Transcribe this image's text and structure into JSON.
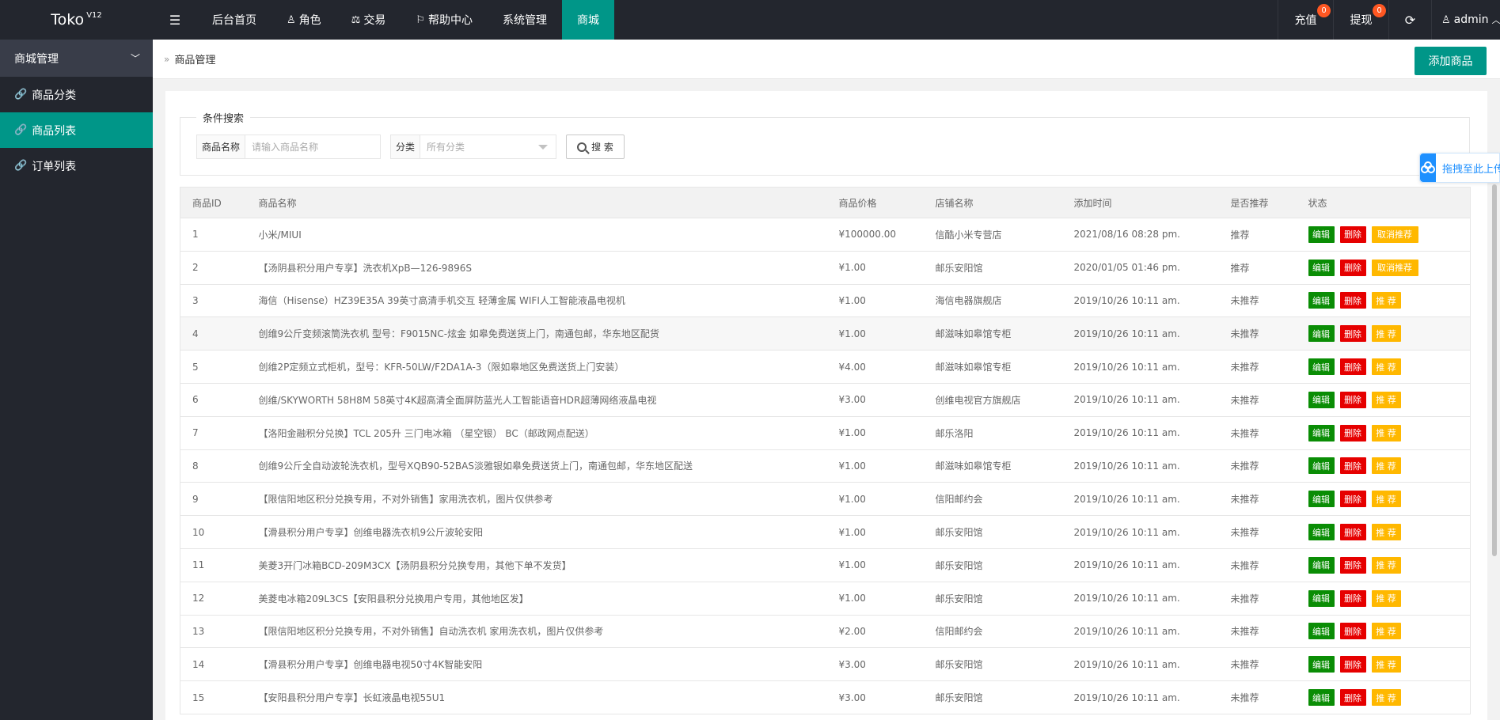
{
  "app": {
    "logo": "Toko",
    "version": "V12"
  },
  "topnav": {
    "items": [
      {
        "label": "后台首页",
        "icon": ""
      },
      {
        "label": "角色",
        "icon": "user-icon"
      },
      {
        "label": "交易",
        "icon": "scale-icon"
      },
      {
        "label": "帮助中心",
        "icon": "flag-icon"
      },
      {
        "label": "系统管理",
        "icon": ""
      },
      {
        "label": "商城",
        "icon": ""
      }
    ],
    "active_index": 5,
    "recharge": {
      "label": "充值",
      "badge": "0"
    },
    "withdraw": {
      "label": "提现",
      "badge": "0"
    },
    "user": "admin"
  },
  "sidebar": {
    "group": "商城管理",
    "items": [
      {
        "label": "商品分类",
        "icon": "link-icon"
      },
      {
        "label": "商品列表",
        "icon": "link-icon"
      },
      {
        "label": "订单列表",
        "icon": "link-icon"
      }
    ],
    "active_index": 1
  },
  "breadcrumb": "商品管理",
  "add_button": "添加商品",
  "search": {
    "legend": "条件搜索",
    "name_label": "商品名称",
    "name_placeholder": "请输入商品名称",
    "category_label": "分类",
    "category_value": "所有分类",
    "button": "搜 索"
  },
  "table": {
    "headers": [
      "商品ID",
      "商品名称",
      "商品价格",
      "店铺名称",
      "添加时间",
      "是否推荐",
      "状态"
    ],
    "actions": {
      "edit": "编辑",
      "delete": "删除",
      "recommend": "推 荐",
      "unrecommend": "取消推荐"
    },
    "rows": [
      {
        "id": "1",
        "name": "小米/MIUI",
        "price": "¥100000.00",
        "shop": "信酷小米专营店",
        "time": "2021/08/16 08:28 pm.",
        "recommended": "推荐"
      },
      {
        "id": "2",
        "name": "【汤阴县积分用户专享】洗衣机XpB—126-9896S",
        "price": "¥1.00",
        "shop": "邮乐安阳馆",
        "time": "2020/01/05 01:46 pm.",
        "recommended": "推荐"
      },
      {
        "id": "3",
        "name": "海信（Hisense）HZ39E35A 39英寸高清手机交互 轻薄金属 WIFI人工智能液晶电视机",
        "price": "¥1.00",
        "shop": "海信电器旗舰店",
        "time": "2019/10/26 10:11 am.",
        "recommended": "未推荐"
      },
      {
        "id": "4",
        "name": "创维9公斤变频滚筒洗衣机 型号：F9015NC-炫金 如皋免费送货上门，南通包邮，华东地区配货",
        "price": "¥1.00",
        "shop": "邮滋味如皋馆专柜",
        "time": "2019/10/26 10:11 am.",
        "recommended": "未推荐"
      },
      {
        "id": "5",
        "name": "创维2P定频立式柜机，型号：KFR-50LW/F2DA1A-3（限如皋地区免费送货上门安装）",
        "price": "¥4.00",
        "shop": "邮滋味如皋馆专柜",
        "time": "2019/10/26 10:11 am.",
        "recommended": "未推荐"
      },
      {
        "id": "6",
        "name": "创维/SKYWORTH 58H8M 58英寸4K超高清全面屏防蓝光人工智能语音HDR超薄网络液晶电视",
        "price": "¥3.00",
        "shop": "创维电视官方旗舰店",
        "time": "2019/10/26 10:11 am.",
        "recommended": "未推荐"
      },
      {
        "id": "7",
        "name": "【洛阳金融积分兑换】TCL 205升 三门电冰箱 （星空银） BC（邮政网点配送）",
        "price": "¥1.00",
        "shop": "邮乐洛阳",
        "time": "2019/10/26 10:11 am.",
        "recommended": "未推荐"
      },
      {
        "id": "8",
        "name": "创维9公斤全自动波轮洗衣机，型号XQB90-52BAS淡雅银如皋免费送货上门，南通包邮，华东地区配送",
        "price": "¥1.00",
        "shop": "邮滋味如皋馆专柜",
        "time": "2019/10/26 10:11 am.",
        "recommended": "未推荐"
      },
      {
        "id": "9",
        "name": "【限信阳地区积分兑换专用，不对外销售】家用洗衣机，图片仅供参考",
        "price": "¥1.00",
        "shop": "信阳邮约会",
        "time": "2019/10/26 10:11 am.",
        "recommended": "未推荐"
      },
      {
        "id": "10",
        "name": "【滑县积分用户专享】创维电器洗衣机9公斤波轮安阳",
        "price": "¥1.00",
        "shop": "邮乐安阳馆",
        "time": "2019/10/26 10:11 am.",
        "recommended": "未推荐"
      },
      {
        "id": "11",
        "name": "美菱3开门冰箱BCD-209M3CX【汤阴县积分兑换专用，其他下单不发货】",
        "price": "¥1.00",
        "shop": "邮乐安阳馆",
        "time": "2019/10/26 10:11 am.",
        "recommended": "未推荐"
      },
      {
        "id": "12",
        "name": "美菱电冰箱209L3CS【安阳县积分兑换用户专用，其他地区发】",
        "price": "¥1.00",
        "shop": "邮乐安阳馆",
        "time": "2019/10/26 10:11 am.",
        "recommended": "未推荐"
      },
      {
        "id": "13",
        "name": "【限信阳地区积分兑换专用，不对外销售】自动洗衣机 家用洗衣机，图片仅供参考",
        "price": "¥2.00",
        "shop": "信阳邮约会",
        "time": "2019/10/26 10:11 am.",
        "recommended": "未推荐"
      },
      {
        "id": "14",
        "name": "【滑县积分用户专享】创维电器电视50寸4K智能安阳",
        "price": "¥3.00",
        "shop": "邮乐安阳馆",
        "time": "2019/10/26 10:11 am.",
        "recommended": "未推荐"
      },
      {
        "id": "15",
        "name": "【安阳县积分用户专享】长虹液晶电视55U1",
        "price": "¥3.00",
        "shop": "邮乐安阳馆",
        "time": "2019/10/26 10:11 am.",
        "recommended": "未推荐"
      }
    ]
  },
  "float_widget": {
    "label": "拖拽至此上传"
  },
  "colors": {
    "accent": "#009688",
    "dark": "#23262e",
    "edit": "#0a8d05",
    "delete": "#e60000",
    "recommend": "#ffb800",
    "badge": "#ff5722"
  }
}
